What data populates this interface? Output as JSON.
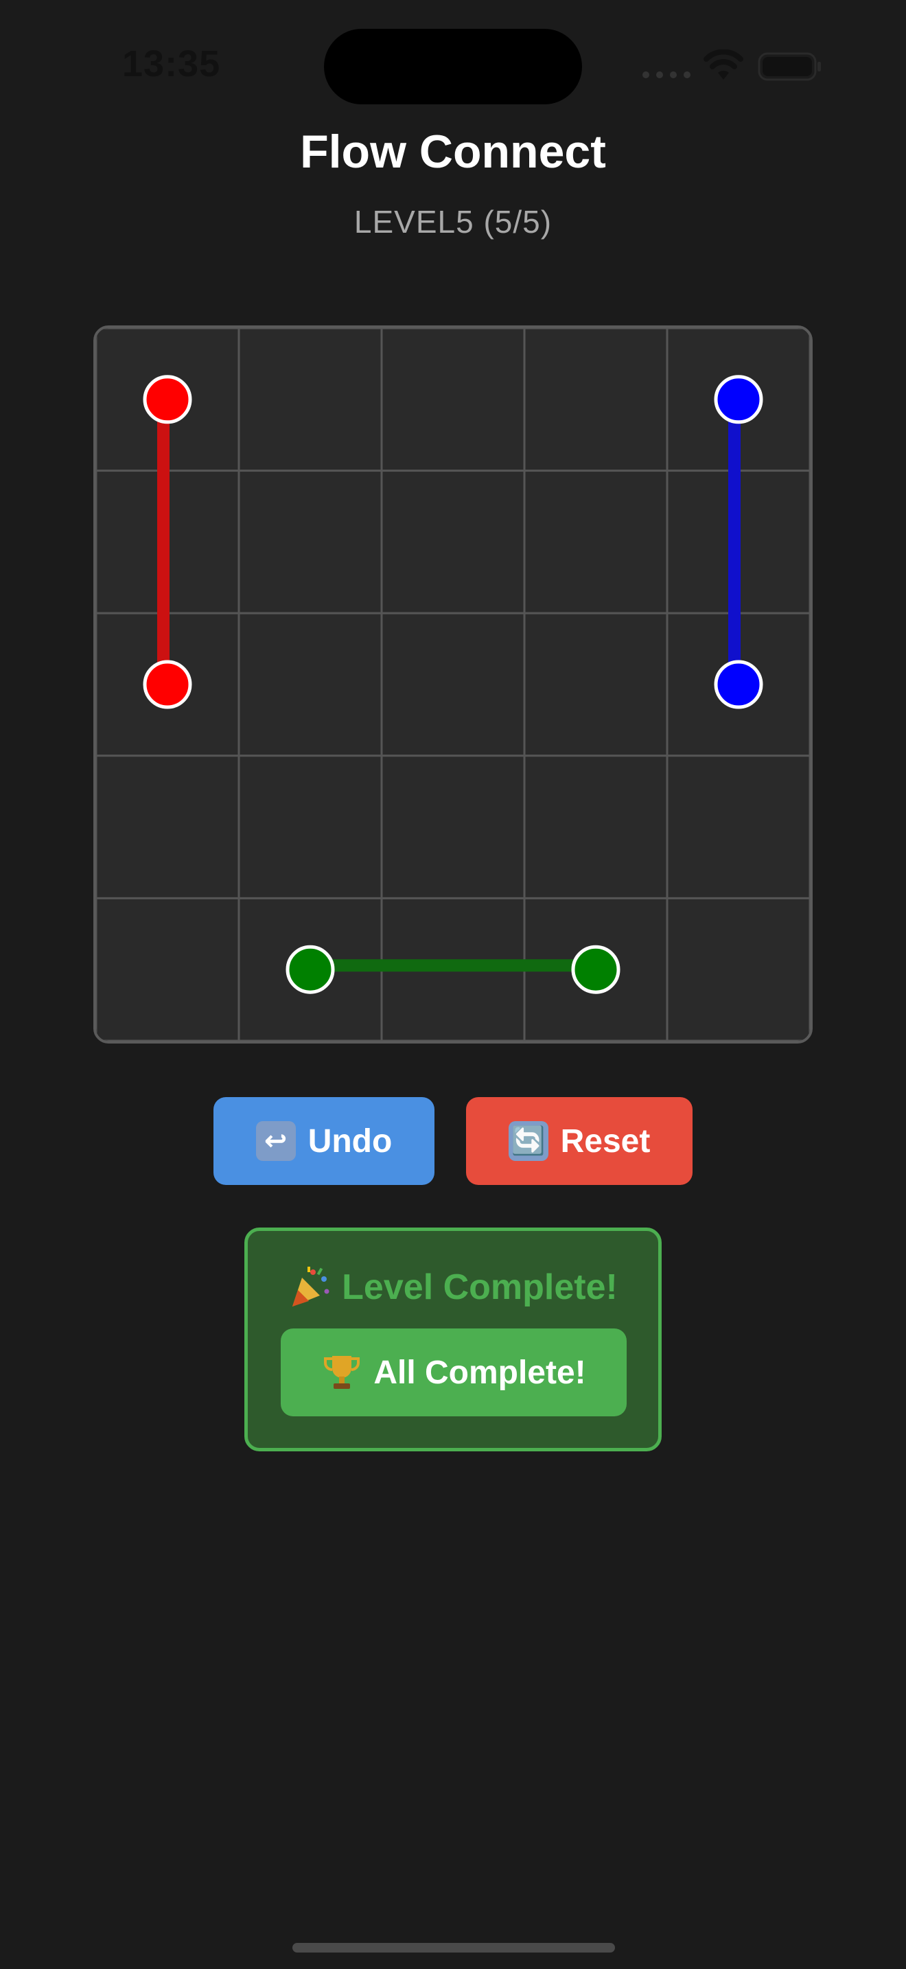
{
  "status_bar": {
    "time": "13:35"
  },
  "header": {
    "title": "Flow Connect",
    "level": "LEVEL5 (5/5)"
  },
  "board": {
    "rows": 5,
    "cols": 5,
    "pairs": [
      {
        "color": "#ff0000",
        "path_color": "#cc1111",
        "start": [
          0,
          0
        ],
        "end": [
          2,
          0
        ]
      },
      {
        "color": "#0000ff",
        "path_color": "#1010cc",
        "start": [
          0,
          4
        ],
        "end": [
          2,
          4
        ]
      },
      {
        "color": "#008000",
        "path_color": "#106a10",
        "start": [
          4,
          1
        ],
        "end": [
          4,
          3
        ]
      }
    ]
  },
  "controls": {
    "undo_label": "Undo",
    "undo_icon": "undo-arrow-icon",
    "reset_label": "Reset",
    "reset_icon": "refresh-icon"
  },
  "completion": {
    "title": "Level Complete!",
    "title_icon": "party-popper-icon",
    "button_label": "All Complete!",
    "button_icon": "trophy-icon"
  },
  "colors": {
    "background": "#1b1b1b",
    "undo": "#4a90e2",
    "reset": "#e74c3c",
    "success": "#4caf50"
  }
}
